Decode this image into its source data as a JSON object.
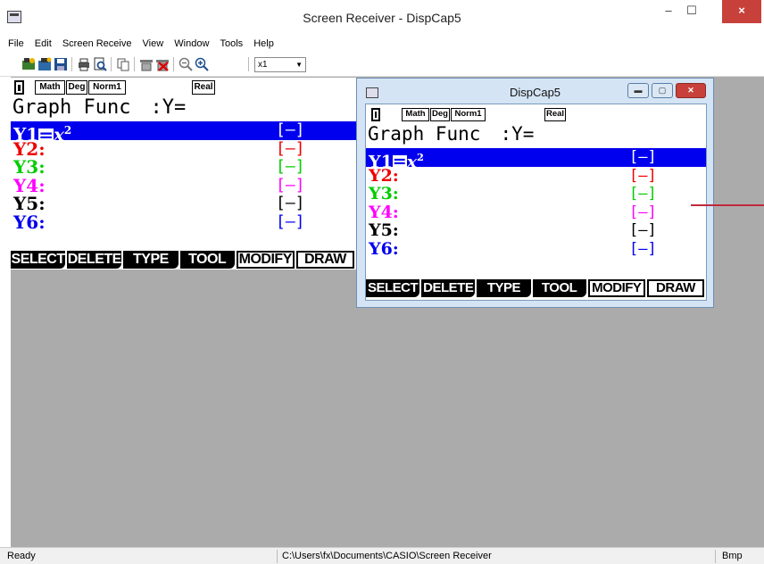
{
  "window": {
    "title": "Screen Receiver - DispCap5",
    "min_label": "–",
    "max_label": "☐",
    "close_label": "×"
  },
  "menu": [
    "File",
    "Edit",
    "Screen Receive",
    "View",
    "Window",
    "Tools",
    "Help"
  ],
  "toolbar": {
    "zoom": "x1"
  },
  "screen": {
    "indicators": [
      "Math",
      "Deg",
      "Norm1"
    ],
    "mode": "Real",
    "header_title": "Graph Func",
    "header_suffix": ":Y=",
    "rows": [
      {
        "label": "Y1",
        "expr": "x",
        "sup": "2",
        "color": "#ffffff",
        "bracket": "[—]",
        "bracket_color": "#ffffff"
      },
      {
        "label": "Y2:",
        "color": "#ee0000",
        "bracket": "[—]",
        "bracket_color": "#ee0000"
      },
      {
        "label": "Y3:",
        "color": "#00cc00",
        "bracket": "[—]",
        "bracket_color": "#00cc00"
      },
      {
        "label": "Y4:",
        "color": "#ff00ff",
        "bracket": "[—]",
        "bracket_color": "#ff00ff"
      },
      {
        "label": "Y5:",
        "color": "#000000",
        "bracket": "[—]",
        "bracket_color": "#000000"
      },
      {
        "label": "Y6:",
        "color": "#0000ee",
        "bracket": "[—]",
        "bracket_color": "#0000ee"
      }
    ],
    "fkeys": [
      "SELECT",
      "DELETE",
      "TYPE",
      "TOOL",
      "MODIFY",
      "DRAW"
    ]
  },
  "inner_window": {
    "title": "DispCap5"
  },
  "status": {
    "left": "Ready",
    "path": "C:\\Users\\fx\\Documents\\CASIO\\Screen Receiver",
    "format": "Bmp"
  },
  "colors": {
    "accent_line": "#c0283c",
    "selection": "#0000ee"
  }
}
